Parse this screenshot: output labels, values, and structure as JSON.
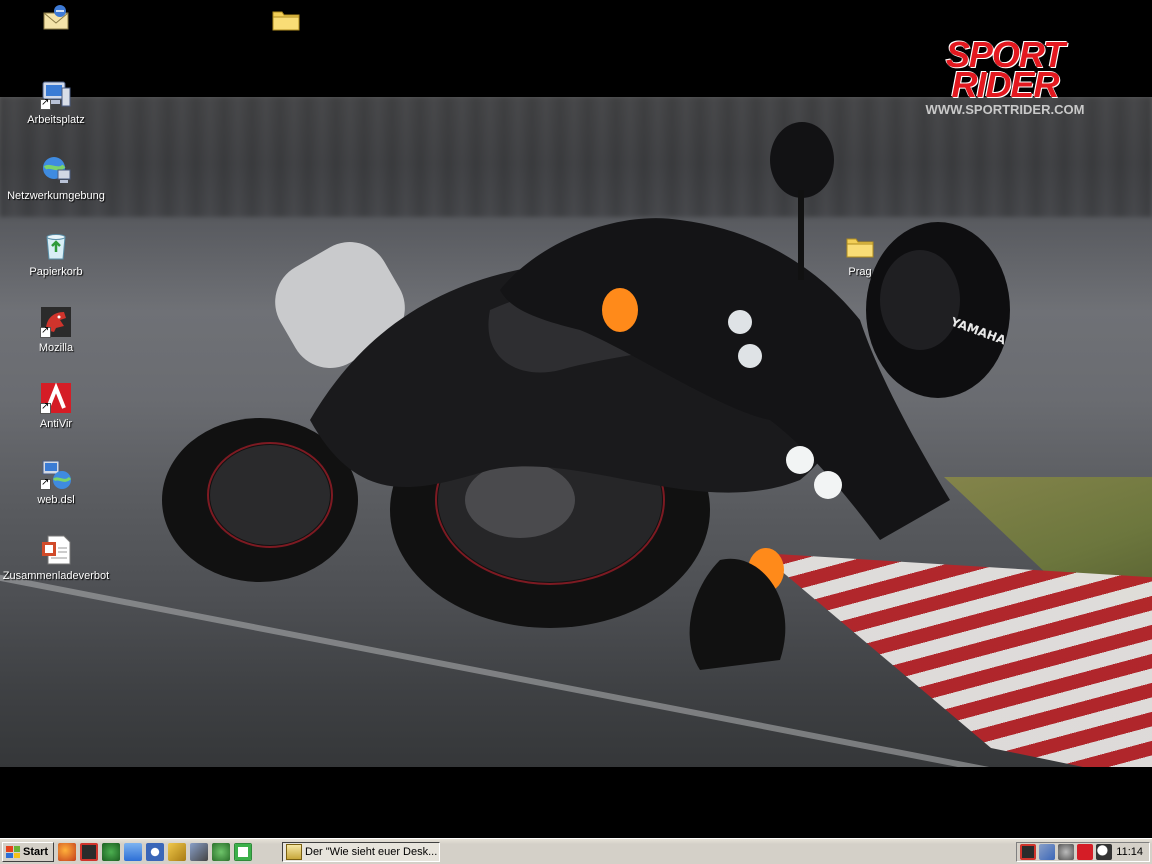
{
  "desktop": {
    "icons": [
      {
        "label": "",
        "icon": "outlook-express-icon"
      },
      {
        "label": "",
        "icon": "folder-icon"
      },
      {
        "label": "Arbeitsplatz",
        "icon": "my-computer-icon"
      },
      {
        "label": "Netzwerkumgebung",
        "icon": "network-places-icon"
      },
      {
        "label": "Papierkorb",
        "icon": "recycle-bin-icon"
      },
      {
        "label": "Mozilla",
        "icon": "mozilla-icon"
      },
      {
        "label": "AntiVir",
        "icon": "antivir-icon"
      },
      {
        "label": "web.dsl",
        "icon": "web-dsl-icon"
      },
      {
        "label": "Zusammenladeverbot",
        "icon": "document-icon"
      },
      {
        "label": "Prag",
        "icon": "folder-icon"
      }
    ]
  },
  "wallpaper": {
    "logo_line1": "SPORT",
    "logo_line2": "RIDER",
    "logo_url": "WWW.SPORTRIDER.COM",
    "helmet_text": "YAMAHA"
  },
  "taskbar": {
    "start_label": "Start",
    "quick_launch": [
      "firefox-icon",
      "mozilla-icon",
      "antivir-pro-icon",
      "outlook-icon",
      "media-player-icon",
      "link-icon",
      "network-tool-icon",
      "settings-icon",
      "excel-icon"
    ],
    "task_button_label": "Der \"Wie sieht euer Desk...",
    "tray_icons": [
      "mozilla-tray-icon",
      "network-tray-icon",
      "volume-tray-icon",
      "antivir-tray-icon",
      "search-tray-icon"
    ],
    "clock": "11:14"
  },
  "colors": {
    "logo_red": "#e3181f",
    "taskbar_bg": "#d4d0c8"
  }
}
